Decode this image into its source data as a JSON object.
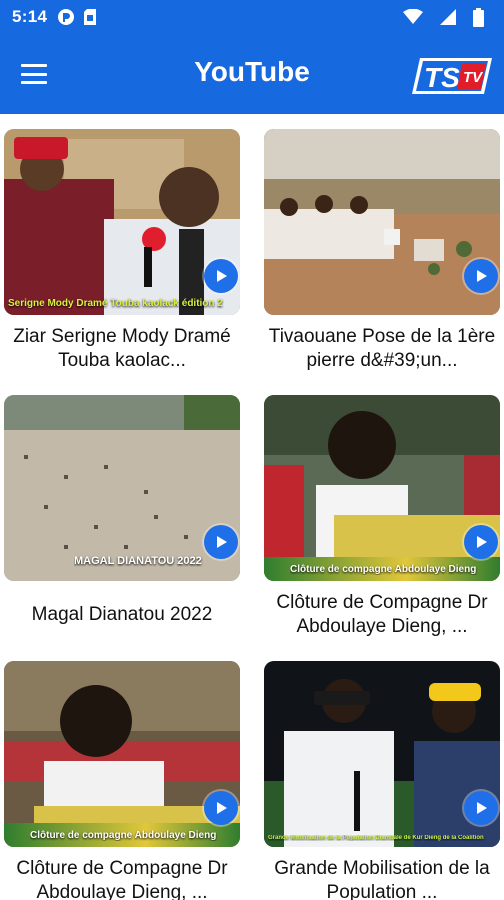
{
  "status_bar": {
    "time": "5:14"
  },
  "app_bar": {
    "title": "YouTube",
    "logo_text": "TS",
    "logo_sub": "TV"
  },
  "colors": {
    "primary": "#1769e0",
    "play": "#1f6fe8"
  },
  "videos": [
    {
      "title": "Ziar Serigne Mody Dramé Touba kaolac...",
      "overlay": "Serigne Mody Dramé Touba kaolack édition 2"
    },
    {
      "title": "Tivaouane  Pose de la 1ère pierre d&#39;un...",
      "overlay": ""
    },
    {
      "title": "Magal Dianatou 2022",
      "overlay": "MAGAL DIANATOU 2022"
    },
    {
      "title": "Clôture de Compagne Dr Abdoulaye Dieng, ...",
      "overlay": "Clôture de compagne Abdoulaye Dieng"
    },
    {
      "title": "Clôture de Compagne Dr Abdoulaye Dieng, ...",
      "overlay": "Clôture de compagne Abdoulaye Dieng"
    },
    {
      "title": "Grande Mobilisation de la Population ...",
      "overlay": "Grande Mobilisation de la Population Diambale de Kur Dieng de la Coalition"
    }
  ]
}
